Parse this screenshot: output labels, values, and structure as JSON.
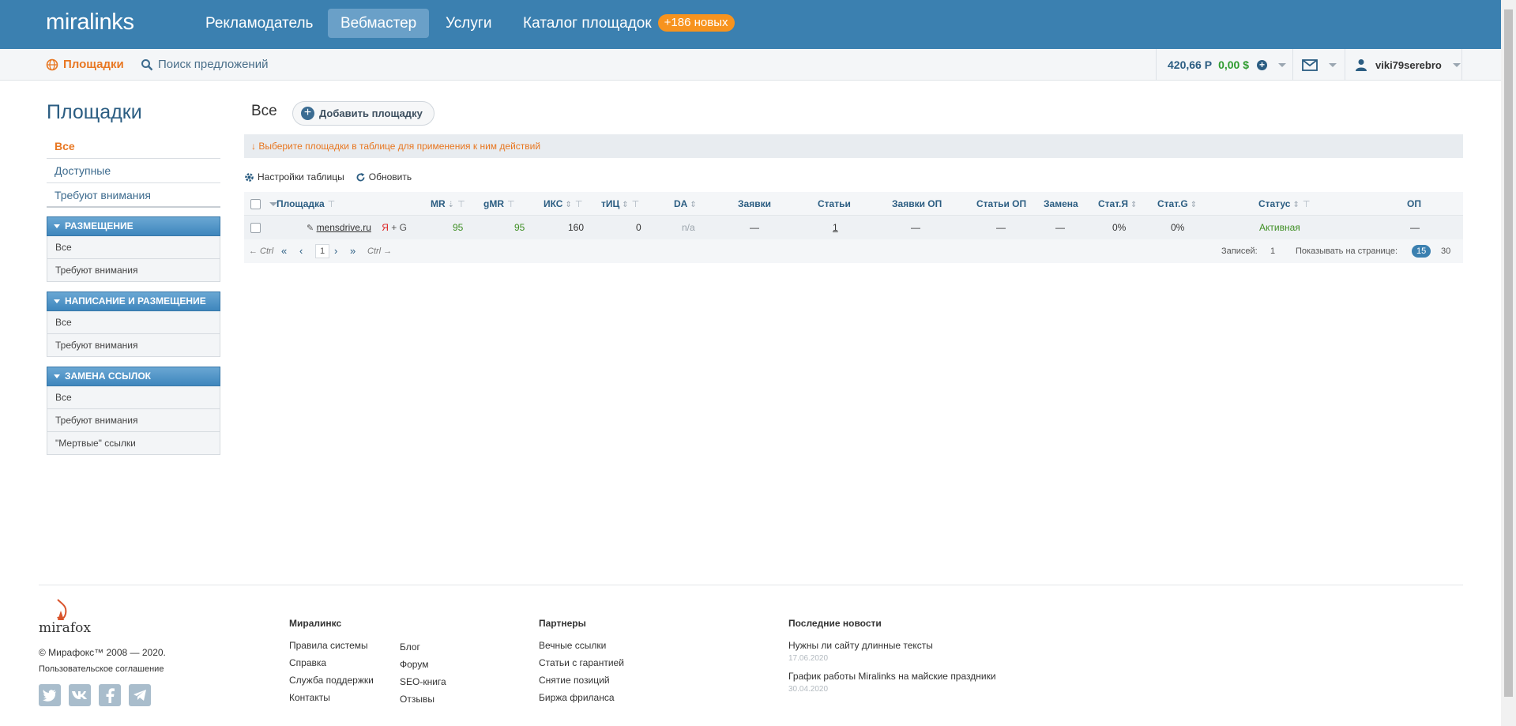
{
  "header": {
    "logo": "miralinks",
    "nav": [
      {
        "label": "Рекламодатель"
      },
      {
        "label": "Вебмастер"
      },
      {
        "label": "Услуги"
      },
      {
        "label": "Каталог площадок"
      }
    ],
    "catalog_badge": "+186 новых",
    "accent_color": "#3b80b0"
  },
  "subheader": {
    "platforms_link": "Площадки",
    "search_link": "Поиск предложений",
    "balance_rub": "420,66 Р",
    "balance_usd": "0,00 $",
    "username": "viki79serebro"
  },
  "sidebar": {
    "title": "Площадки",
    "menu": [
      "Все",
      "Доступные",
      "Требуют внимания"
    ],
    "groups": [
      {
        "title": "Размещение",
        "items": [
          "Все",
          "Требуют внимания"
        ]
      },
      {
        "title": "Написание и размещение",
        "items": [
          "Все",
          "Требуют внимания"
        ]
      },
      {
        "title": "Замена ссылок",
        "items": [
          "Все",
          "Требуют внимания",
          "\"Мертвые\" ссылки"
        ]
      }
    ]
  },
  "main": {
    "title": "Все",
    "add_button": "Добавить площадку",
    "hint": "↓  Выберите площадки в таблице для применения к ним действий",
    "table_settings": "Настройки таблицы",
    "refresh": "Обновить",
    "columns": [
      "Площадка",
      "MR",
      "gMR",
      "ИКС",
      "тИЦ",
      "DA",
      "Заявки",
      "Статьи",
      "Заявки ОП",
      "Статьи ОП",
      "Замена",
      "Стат.Я",
      "Стат.G",
      "Статус",
      "ОП"
    ],
    "rows": [
      {
        "site": "mensdrive.ru",
        "engines_ya": "Я",
        "engines_g": "+ G",
        "mr": "95",
        "gmr": "95",
        "iks": "160",
        "tic": "0",
        "da": "n/a",
        "requests": "—",
        "articles": "1",
        "requests_op": "—",
        "articles_op": "—",
        "replace": "—",
        "stat_ya": "0%",
        "stat_g": "0%",
        "status": "Активная",
        "op": "—"
      }
    ],
    "pager": {
      "prev_hint": "← Ctrl",
      "first": "«",
      "prev": "‹",
      "page": "1",
      "next": "›",
      "last": "»",
      "next_hint": "Ctrl →",
      "records_label": "Записей:",
      "records_count": "1",
      "per_page_label": "Показывать на странице:",
      "per_page_options": [
        "15",
        "30"
      ]
    }
  },
  "footer": {
    "brand": "mirafox",
    "copyright": "© Мирафокс™ 2008 — 2020.",
    "agreement": "Пользовательское соглашение",
    "col1_title": "Миралинкс",
    "col1_a": [
      "Правила системы",
      "Справка",
      "Служба поддержки",
      "Контакты"
    ],
    "col1_b": [
      "Блог",
      "Форум",
      "SEO-книга",
      "Отзывы"
    ],
    "col2_title": "Партнеры",
    "col2": [
      "Вечные ссылки",
      "Статьи с гарантией",
      "Снятие позиций",
      "Биржа фриланса"
    ],
    "news_title": "Последние новости",
    "news": [
      {
        "title": "Нужны ли сайту длинные тексты",
        "date": "17.06.2020"
      },
      {
        "title": "График работы Miralinks на майские праздники",
        "date": "30.04.2020"
      }
    ]
  }
}
